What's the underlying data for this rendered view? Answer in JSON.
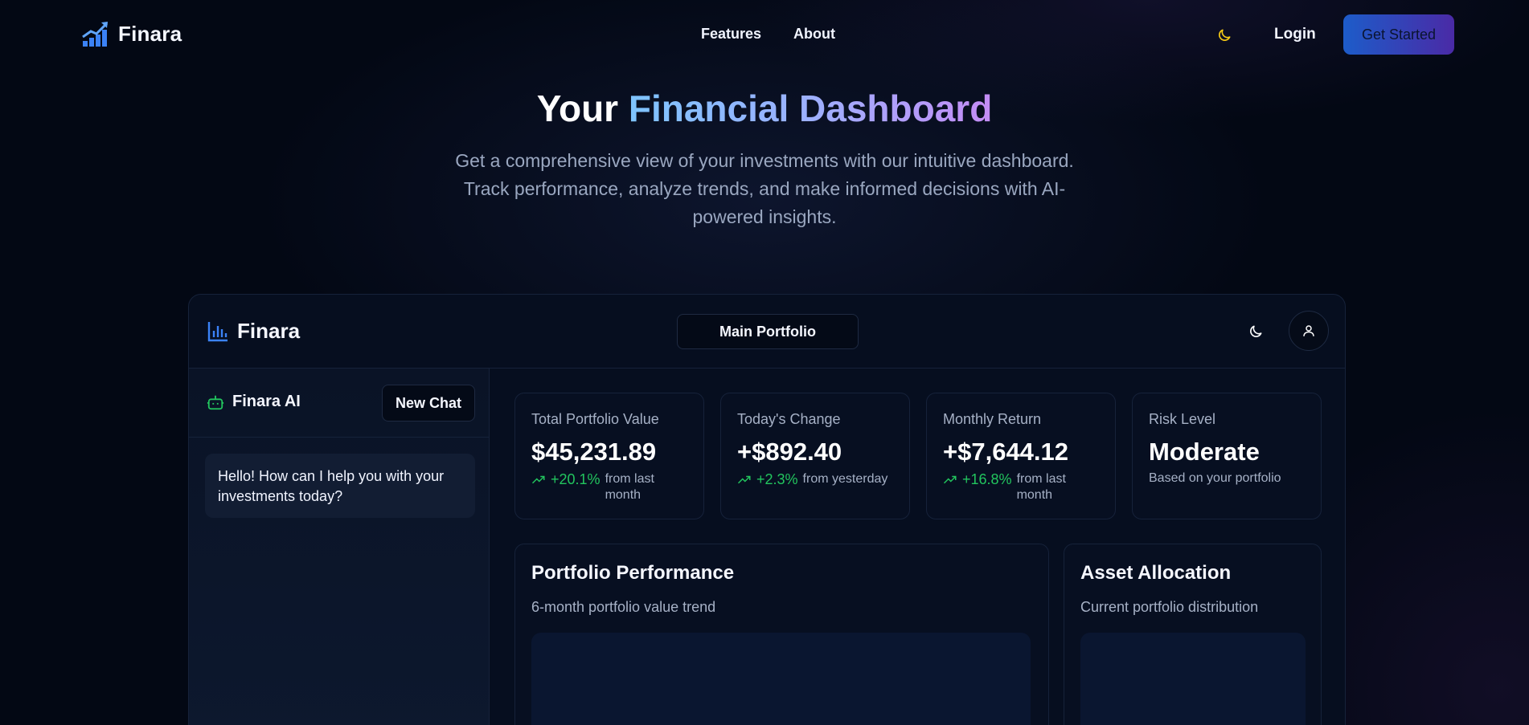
{
  "nav": {
    "brand": "Finara",
    "links": [
      "Features",
      "About"
    ],
    "login": "Login",
    "cta": "Get Started"
  },
  "hero": {
    "title_plain": "Your",
    "title_gradient": "Financial Dashboard",
    "subtitle": "Get a comprehensive view of your investments with our intuitive dashboard. Track performance, analyze trends, and make informed decisions with AI-powered insights."
  },
  "dashboard": {
    "brand": "Finara",
    "portfolio_selector": "Main Portfolio",
    "chat": {
      "title": "Finara AI",
      "new_chat": "New Chat",
      "greeting": "Hello! How can I help you with your investments today?"
    },
    "stats": [
      {
        "label": "Total Portfolio Value",
        "value": "$45,231.89",
        "trend": "+20.1%",
        "note": "from last month"
      },
      {
        "label": "Today's Change",
        "value": "+$892.40",
        "trend": "+2.3%",
        "note": "from yesterday"
      },
      {
        "label": "Monthly Return",
        "value": "+$7,644.12",
        "trend": "+16.8%",
        "note": "from last month"
      },
      {
        "label": "Risk Level",
        "value": "Moderate",
        "note": "Based on your portfolio"
      }
    ],
    "performance": {
      "title": "Portfolio Performance",
      "subtitle": "6-month portfolio value trend"
    },
    "allocation": {
      "title": "Asset Allocation",
      "subtitle": "Current portfolio distribution"
    }
  },
  "colors": {
    "background": "#030814",
    "accent_blue": "#3b82f6",
    "accent_green": "#22c55e",
    "moon_yellow": "#facc15"
  },
  "icons": {
    "brand_logo": "trending-up-bars-icon",
    "theme_toggle": "moon-icon",
    "dashboard_logo": "bar-chart-icon",
    "chat_bot": "bot-icon",
    "user": "user-icon",
    "trend": "trending-up-icon"
  }
}
